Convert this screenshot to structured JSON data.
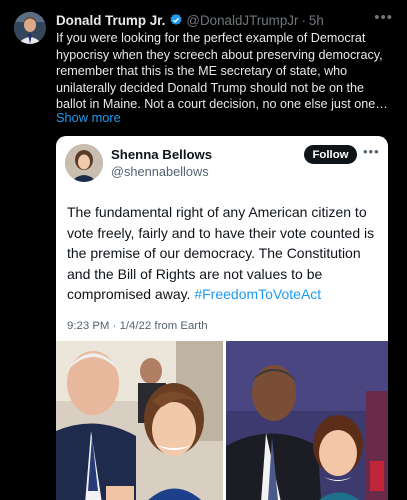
{
  "post": {
    "author_name": "Donald Trump Jr.",
    "handle": "@DonaldJTrumpJr",
    "separator": "·",
    "time": "5h",
    "more_icon": "more-horizontal-icon",
    "text": "If you were looking for the perfect example of Democrat hypocrisy when they screech about preserving democracy, remember that this is the ME secretary of state, who unilaterally decided Donald Trump should not be on the ballot in Maine. Not a court decision, no one else just one…",
    "show_more": "Show more"
  },
  "quote": {
    "author_name": "Shenna Bellows",
    "handle": "@shennabellows",
    "follow_label": "Follow",
    "text": "The fundamental right of any American citizen to vote freely, fairly and to have their vote counted is the premise of our democracy. The Constitution and the Bill of Rights are not values to be compromised away. ",
    "hashtag": "#FreedomToVoteAct",
    "time": "9:23 PM",
    "separator": "·",
    "date": "1/4/22",
    "source": "from Earth"
  },
  "colors": {
    "background": "#000000",
    "accent": "#1d9bf0",
    "verified": "#1d9bf0",
    "follow_button": "#0f1419",
    "card": "#ffffff"
  }
}
